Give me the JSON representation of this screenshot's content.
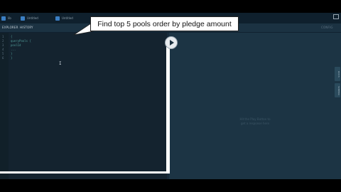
{
  "tabs": [
    {
      "label": "lib"
    },
    {
      "label": "Untitled"
    },
    {
      "label": "Untitled"
    }
  ],
  "toolbar": {
    "explore_label": "EXPLORER",
    "history_label": "HISTORY",
    "right_label": "CONFIG"
  },
  "editor": {
    "line_numbers": [
      "1",
      "2",
      "3",
      "4",
      "5",
      "6"
    ],
    "code_lines": [
      "{",
      "  queryPools {",
      "    poolId",
      "    ...",
      "  }",
      "}"
    ]
  },
  "result": {
    "hint_line_1": "Hit the Play Button to",
    "hint_line_2": "get a response here"
  },
  "sidetabs": [
    "DOCS",
    "SCHEMA"
  ],
  "callout": {
    "text": "Find top 5 pools order by pledge amount"
  }
}
